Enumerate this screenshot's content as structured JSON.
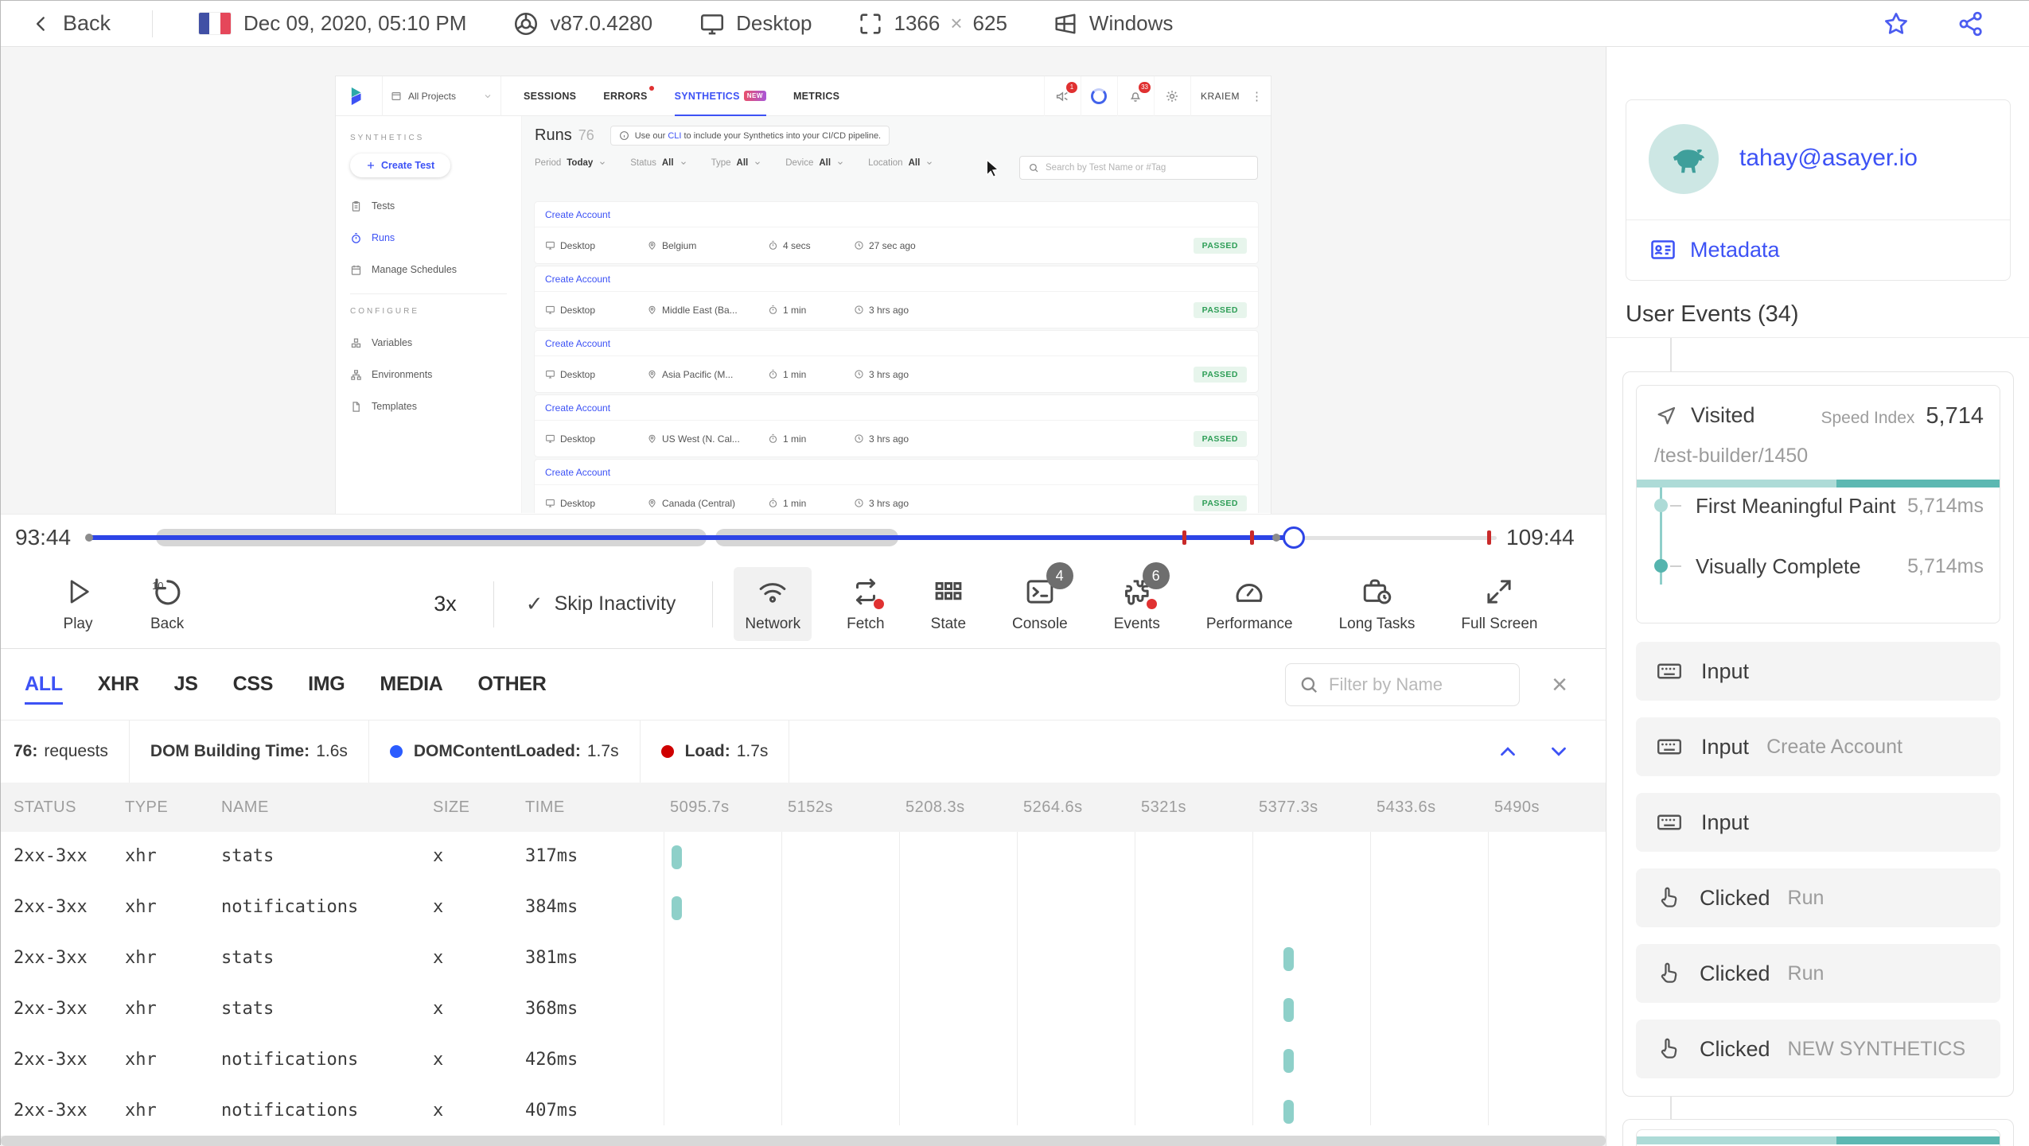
{
  "colors": {
    "accent": "#3d52f5",
    "teal_dark": "#5cb8b2",
    "teal_light": "#addbd7",
    "passed_green": "#2e9e57",
    "alert_red": "#e03131",
    "timeline_blue": "#2d44e6"
  },
  "topbar": {
    "back_label": "Back",
    "date": "Dec 09, 2020, 05:10 PM",
    "browser_version": "v87.0.4280",
    "device": "Desktop",
    "resolution_w": "1366",
    "resolution_x": "×",
    "resolution_h": "625",
    "os": "Windows"
  },
  "app": {
    "project_selector": "All Projects",
    "tabs": {
      "sessions": "SESSIONS",
      "errors": "ERRORS",
      "synthetics": "SYNTHETICS",
      "synthetics_badge": "NEW",
      "metrics": "METRICS"
    },
    "announce_badge": "1",
    "notif_badge": "33",
    "user": "KRAIEM",
    "sidebar": {
      "section1": "SYNTHETICS",
      "create_button": "Create Test",
      "tests": "Tests",
      "runs": "Runs",
      "schedules": "Manage Schedules",
      "section2": "CONFIGURE",
      "variables": "Variables",
      "environments": "Environments",
      "templates": "Templates"
    },
    "runs": {
      "title": "Runs",
      "count": "76",
      "notice_pre": "Use our ",
      "notice_link": "CLI",
      "notice_post": " to include your Synthetics into your CI/CD pipeline.",
      "filters": [
        {
          "label": "Period",
          "value": "Today"
        },
        {
          "label": "Status",
          "value": "All"
        },
        {
          "label": "Type",
          "value": "All"
        },
        {
          "label": "Device",
          "value": "All"
        },
        {
          "label": "Location",
          "value": "All"
        }
      ],
      "search_placeholder": "Search by Test Name or #Tag",
      "groups": [
        {
          "name": "Create Account",
          "device": "Desktop",
          "location": "Belgium",
          "duration": "4 secs",
          "ago": "27 sec ago",
          "status": "PASSED"
        },
        {
          "name": "Create Account",
          "device": "Desktop",
          "location": "Middle East (Ba...",
          "duration": "1 min",
          "ago": "3 hrs ago",
          "status": "PASSED"
        },
        {
          "name": "Create Account",
          "device": "Desktop",
          "location": "Asia Pacific (M...",
          "duration": "1 min",
          "ago": "3 hrs ago",
          "status": "PASSED"
        },
        {
          "name": "Create Account",
          "device": "Desktop",
          "location": "US West (N. Cal...",
          "duration": "1 min",
          "ago": "3 hrs ago",
          "status": "PASSED"
        },
        {
          "name": "Create Account",
          "device": "Desktop",
          "location": "Canada (Central)",
          "duration": "1 min",
          "ago": "3 hrs ago",
          "status": "PASSED"
        }
      ]
    }
  },
  "player": {
    "time_start": "93:44",
    "time_end": "109:44",
    "play_label": "Play",
    "back_label": "Back",
    "back_amount": "10",
    "speed": "3x",
    "skip_inactivity": "Skip Inactivity",
    "network_label": "Network",
    "fetch_label": "Fetch",
    "state_label": "State",
    "console_label": "Console",
    "console_badge": "4",
    "events_label": "Events",
    "events_badge": "6",
    "performance_label": "Performance",
    "longtasks_label": "Long Tasks",
    "fullscreen_label": "Full Screen"
  },
  "network": {
    "tabs": [
      "ALL",
      "XHR",
      "JS",
      "CSS",
      "IMG",
      "MEDIA",
      "OTHER"
    ],
    "active_tab": "ALL",
    "filter_placeholder": "Filter by Name",
    "requests_count": "76:",
    "requests_label": "requests",
    "dom_label": "DOM Building Time:",
    "dom_value": "1.6s",
    "dcl_label": "DOMContentLoaded:",
    "dcl_value": "1.7s",
    "load_label": "Load:",
    "load_value": "1.7s",
    "columns": {
      "status": "STATUS",
      "type": "TYPE",
      "name": "NAME",
      "size": "SIZE",
      "time": "TIME"
    },
    "ticks": [
      "5095.7s",
      "5152s",
      "5208.3s",
      "5264.6s",
      "5321s",
      "5377.3s",
      "5433.6s",
      "5490s"
    ],
    "rows": [
      {
        "status": "2xx-3xx",
        "type": "xhr",
        "name": "stats",
        "size": "x",
        "time": "317ms"
      },
      {
        "status": "2xx-3xx",
        "type": "xhr",
        "name": "notifications",
        "size": "x",
        "time": "384ms"
      },
      {
        "status": "2xx-3xx",
        "type": "xhr",
        "name": "stats",
        "size": "x",
        "time": "381ms"
      },
      {
        "status": "2xx-3xx",
        "type": "xhr",
        "name": "stats",
        "size": "x",
        "time": "368ms"
      },
      {
        "status": "2xx-3xx",
        "type": "xhr",
        "name": "notifications",
        "size": "x",
        "time": "426ms"
      },
      {
        "status": "2xx-3xx",
        "type": "xhr",
        "name": "notifications",
        "size": "x",
        "time": "407ms"
      }
    ]
  },
  "events_panel": {
    "email": "tahay@asayer.io",
    "metadata_label": "Metadata",
    "heading": "User Events (34)",
    "visited": {
      "label": "Visited",
      "speed_index_label": "Speed Index",
      "speed_index": "5,714",
      "url": "/test-builder/1450",
      "metric1_label": "First Meaningful Paint",
      "metric1_value": "5,714ms",
      "metric2_label": "Visually Complete",
      "metric2_value": "5,714ms"
    },
    "events": [
      {
        "type": "Input",
        "detail": ""
      },
      {
        "type": "Input",
        "detail": "Create Account"
      },
      {
        "type": "Input",
        "detail": ""
      },
      {
        "type": "Clicked",
        "detail": "Run"
      },
      {
        "type": "Clicked",
        "detail": "Run"
      },
      {
        "type": "Clicked",
        "detail": "NEW SYNTHETICS"
      }
    ]
  }
}
